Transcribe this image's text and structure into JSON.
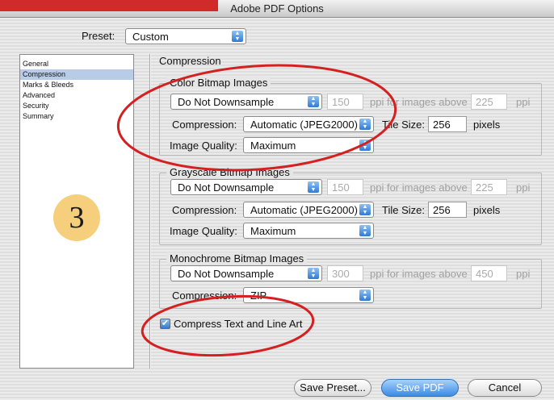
{
  "window": {
    "title": "Adobe PDF Options"
  },
  "preset": {
    "label": "Preset:",
    "value": "Custom"
  },
  "sidebar": {
    "items": [
      {
        "label": "General"
      },
      {
        "label": "Compression"
      },
      {
        "label": "Marks & Bleeds"
      },
      {
        "label": "Advanced"
      },
      {
        "label": "Security"
      },
      {
        "label": "Summary"
      }
    ],
    "selected": "Compression"
  },
  "badge": {
    "number": "3"
  },
  "section_title": "Compression",
  "color_images": {
    "title": "Color Bitmap Images",
    "downsample": "Do Not Downsample",
    "ppi": "150",
    "ppi_label": "ppi for images above",
    "above": "225",
    "ppi_suffix": "ppi",
    "compression_label": "Compression:",
    "compression": "Automatic (JPEG2000)",
    "tile_label": "Tile Size:",
    "tile": "256",
    "tile_unit": "pixels",
    "quality_label": "Image Quality:",
    "quality": "Maximum"
  },
  "grayscale_images": {
    "title": "Grayscale Bitmap Images",
    "downsample": "Do Not Downsample",
    "ppi": "150",
    "ppi_label": "ppi for images above",
    "above": "225",
    "ppi_suffix": "ppi",
    "compression_label": "Compression:",
    "compression": "Automatic (JPEG2000)",
    "tile_label": "Tile Size:",
    "tile": "256",
    "tile_unit": "pixels",
    "quality_label": "Image Quality:",
    "quality": "Maximum"
  },
  "mono_images": {
    "title": "Monochrome Bitmap Images",
    "downsample": "Do Not Downsample",
    "ppi": "300",
    "ppi_label": "ppi for images above",
    "above": "450",
    "ppi_suffix": "ppi",
    "compression_label": "Compression:",
    "compression": "ZIP"
  },
  "compress_text": {
    "label": "Compress Text and Line Art",
    "checked": true
  },
  "buttons": {
    "save_preset": "Save Preset...",
    "save_pdf": "Save PDF",
    "cancel": "Cancel"
  },
  "colors": {
    "annotation_red": "#d42020",
    "selected_blue": "#b8cce8",
    "accent_blue": "#3c8ae6",
    "badge_yellow": "#f6cf7c"
  }
}
